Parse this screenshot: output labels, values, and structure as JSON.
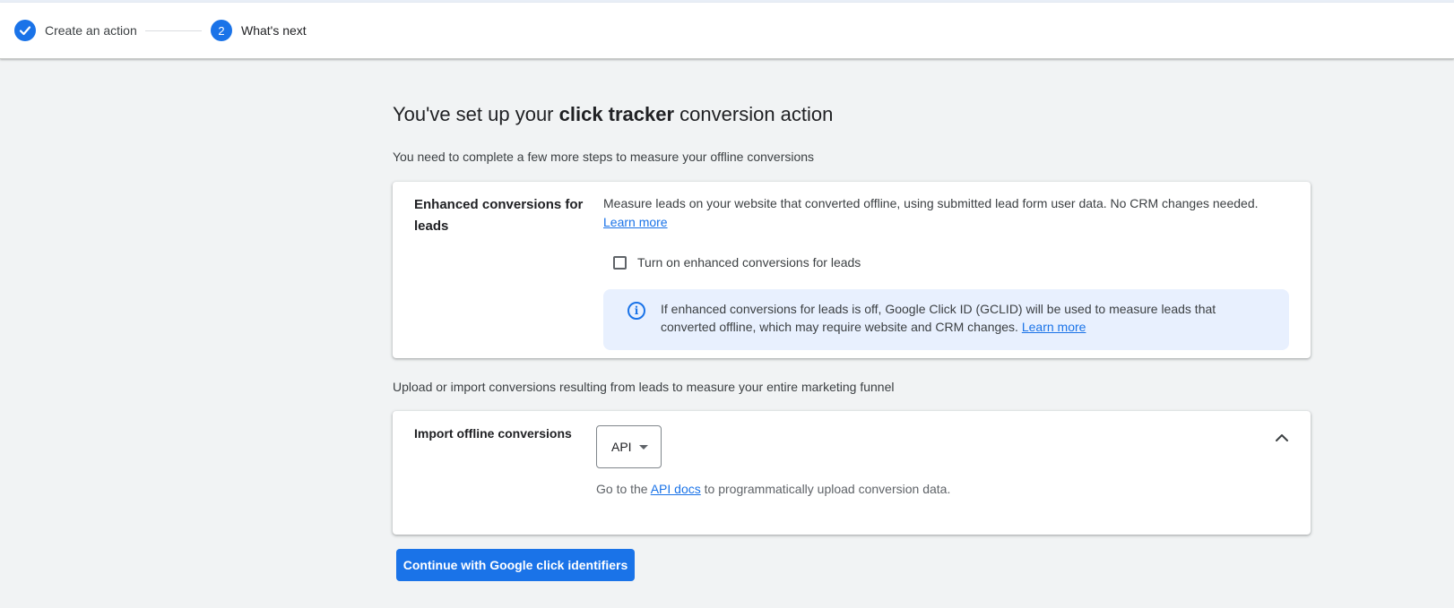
{
  "stepper": {
    "steps": [
      {
        "label": "Create an action",
        "state": "complete",
        "icon": "check-icon"
      },
      {
        "label": "What's next",
        "number": "2",
        "state": "active"
      }
    ]
  },
  "header": {
    "title_prefix": "You've set up your ",
    "title_bold": "click tracker",
    "title_suffix": " conversion action",
    "subtitle": "You need to complete a few more steps to measure your offline conversions"
  },
  "enhanced": {
    "title": "Enhanced conversions for leads",
    "description": "Measure leads on your website that converted offline, using submitted lead form user data. No CRM changes needed.",
    "learn_more": "Learn more",
    "checkbox_label": "Turn on enhanced conversions for leads",
    "checkbox_checked": false,
    "info_text": "If enhanced conversions for leads is off, Google Click ID (GCLID) will be used to measure leads that converted offline, which may require website and CRM changes.",
    "info_learn_more": "Learn more"
  },
  "funnel_text": "Upload or import conversions resulting from leads to measure your entire marketing funnel",
  "import": {
    "title": "Import offline conversions",
    "method_selected": "API",
    "api_prefix": "Go to the ",
    "api_link": "API docs",
    "api_suffix": " to programmatically upload conversion data."
  },
  "continue_button": "Continue with Google click identifiers",
  "colors": {
    "accent": "#1a73e8",
    "background": "#f1f3f4",
    "info_background": "#e8f0fe"
  }
}
